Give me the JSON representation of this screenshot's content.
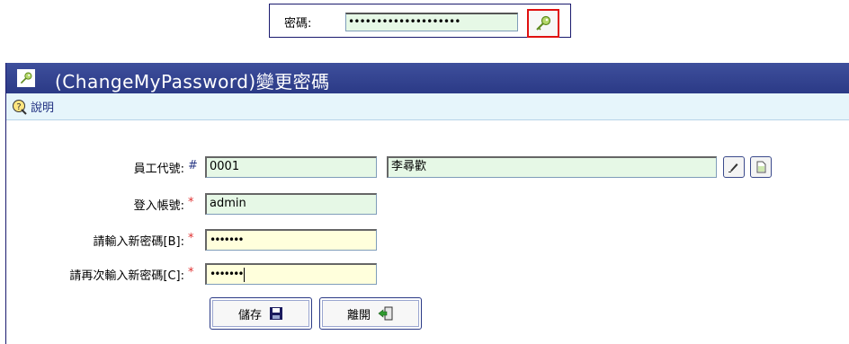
{
  "top_strip": {
    "label": "密碼:",
    "password_masked": "••••••••••••••••••••"
  },
  "window": {
    "title": "(ChangeMyPassword)變更密碼"
  },
  "toolbar": {
    "help_label": "說明"
  },
  "form": {
    "employee_id_label": "員工代號:",
    "employee_id_mark": "#",
    "employee_id_value": "0001",
    "employee_name_value": "李尋歡",
    "login_label": "登入帳號:",
    "login_mark": "*",
    "login_value": "admin",
    "new_pw_label": "請輸入新密碼[B]:",
    "new_pw_mark": "*",
    "new_pw_value": "•••••••",
    "confirm_pw_label": "請再次輸入新密碼[C]:",
    "confirm_pw_mark": "*",
    "confirm_pw_value": "•••••••"
  },
  "buttons": {
    "save_label": "儲存",
    "exit_label": "離開"
  },
  "colors": {
    "title_bg": "#2b3a86",
    "field_green": "#e6f8e6",
    "field_yellow": "#ffffdc",
    "required": "#e03030"
  }
}
